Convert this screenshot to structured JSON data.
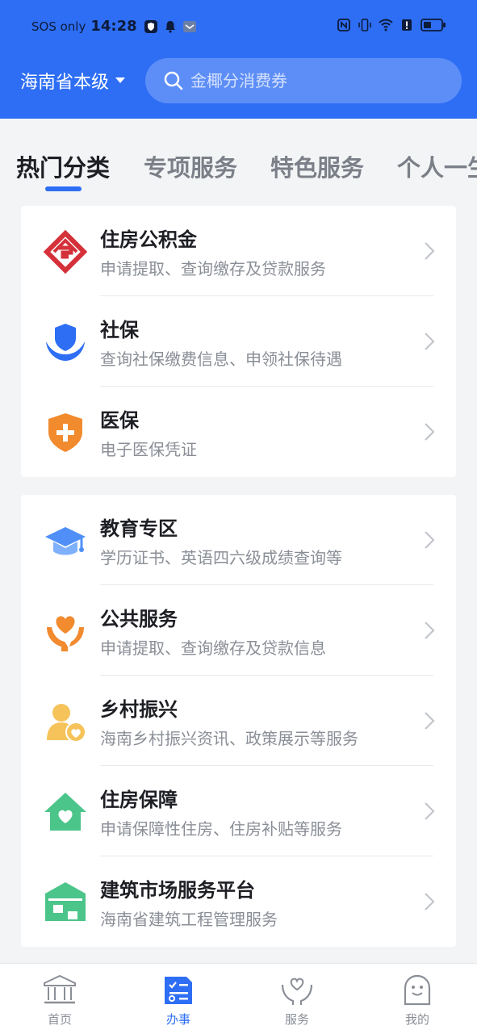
{
  "status_bar": {
    "carrier": "SOS only",
    "time": "14:28"
  },
  "header": {
    "region": "海南省本级",
    "search_placeholder": "金椰分消费券"
  },
  "tabs": [
    {
      "label": "热门分类",
      "active": true
    },
    {
      "label": "专项服务",
      "active": false
    },
    {
      "label": "特色服务",
      "active": false
    },
    {
      "label": "个人一生",
      "active": false
    }
  ],
  "card1": [
    {
      "title": "住房公积金",
      "desc": "申请提取、查询缴存及贷款服务",
      "icon": "housing-fund-icon"
    },
    {
      "title": "社保",
      "desc": "查询社保缴费信息、申领社保待遇",
      "icon": "social-security-icon"
    },
    {
      "title": "医保",
      "desc": "电子医保凭证",
      "icon": "medical-insurance-icon"
    }
  ],
  "card2": [
    {
      "title": "教育专区",
      "desc": "学历证书、英语四六级成绩查询等",
      "icon": "graduation-cap-icon"
    },
    {
      "title": "公共服务",
      "desc": "申请提取、查询缴存及贷款信息",
      "icon": "public-service-icon"
    },
    {
      "title": "乡村振兴",
      "desc": "海南乡村振兴资讯、政策展示等服务",
      "icon": "rural-revitalization-icon"
    },
    {
      "title": "住房保障",
      "desc": "申请保障性住房、住房补贴等服务",
      "icon": "housing-security-icon"
    },
    {
      "title": "建筑市场服务平台",
      "desc": "海南省建筑工程管理服务",
      "icon": "building-market-icon"
    }
  ],
  "bottom_nav": [
    {
      "label": "首页",
      "icon": "home-icon",
      "active": false
    },
    {
      "label": "办事",
      "icon": "tasks-icon",
      "active": true
    },
    {
      "label": "服务",
      "icon": "service-hands-icon",
      "active": false
    },
    {
      "label": "我的",
      "icon": "profile-icon",
      "active": false
    }
  ],
  "colors": {
    "primary": "#2e6ef4",
    "search_bg": "#5d8ef7",
    "background": "#f3f4f6"
  }
}
